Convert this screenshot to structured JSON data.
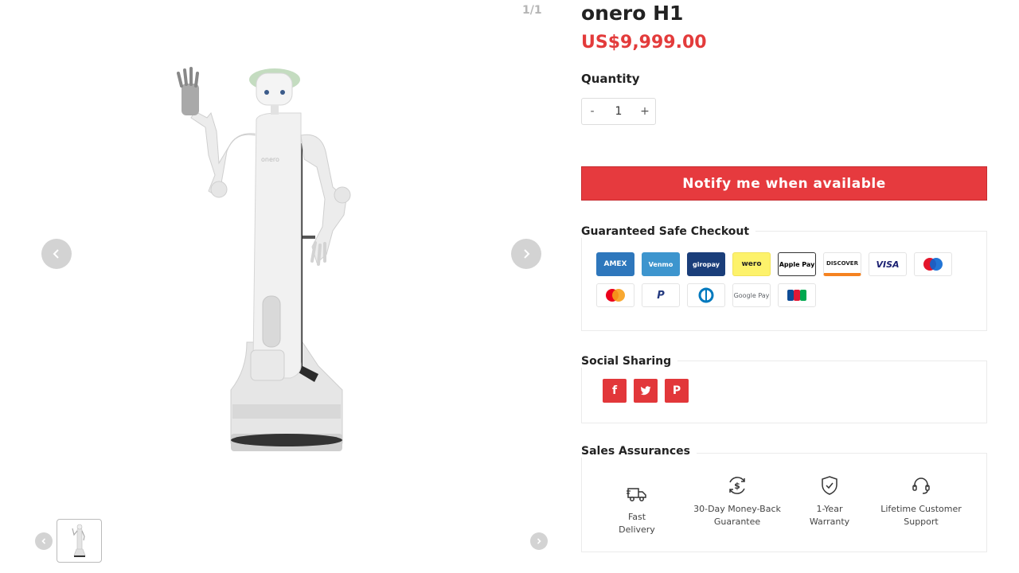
{
  "gallery": {
    "counter": "1/1",
    "prev_icon": "chevron-left-icon",
    "next_icon": "chevron-right-icon"
  },
  "product": {
    "title": "onero H1",
    "price": "US$9,999.00",
    "robot_brand_text": "onero"
  },
  "quantity": {
    "label": "Quantity",
    "minus": "-",
    "value": "1",
    "plus": "+"
  },
  "notify_button": "Notify me when available",
  "checkout": {
    "title": "Guaranteed Safe Checkout",
    "methods": [
      "AMEX",
      "Venmo",
      "giropay",
      "wero",
      "Apple Pay",
      "DISCOVER",
      "VISA",
      "Maestro",
      "Mastercard",
      "PayPal",
      "Diners Club",
      "Google Pay",
      "JCB"
    ]
  },
  "social": {
    "title": "Social Sharing",
    "facebook": "f",
    "twitter": "twitter-icon",
    "pinterest": "P"
  },
  "assurances": {
    "title": "Sales Assurances",
    "items": [
      {
        "line1": "Fast Delivery",
        "line2": "",
        "icon": "truck-icon"
      },
      {
        "line1": "30-Day Money-Back",
        "line2": "Guarantee",
        "icon": "money-back-icon"
      },
      {
        "line1": "1-Year",
        "line2": "Warranty",
        "icon": "shield-check-icon"
      },
      {
        "line1": "Lifetime Customer",
        "line2": "Support",
        "icon": "headset-icon"
      }
    ]
  },
  "colors": {
    "accent_red": "#e63a3e",
    "price_red": "#e33b3b"
  }
}
